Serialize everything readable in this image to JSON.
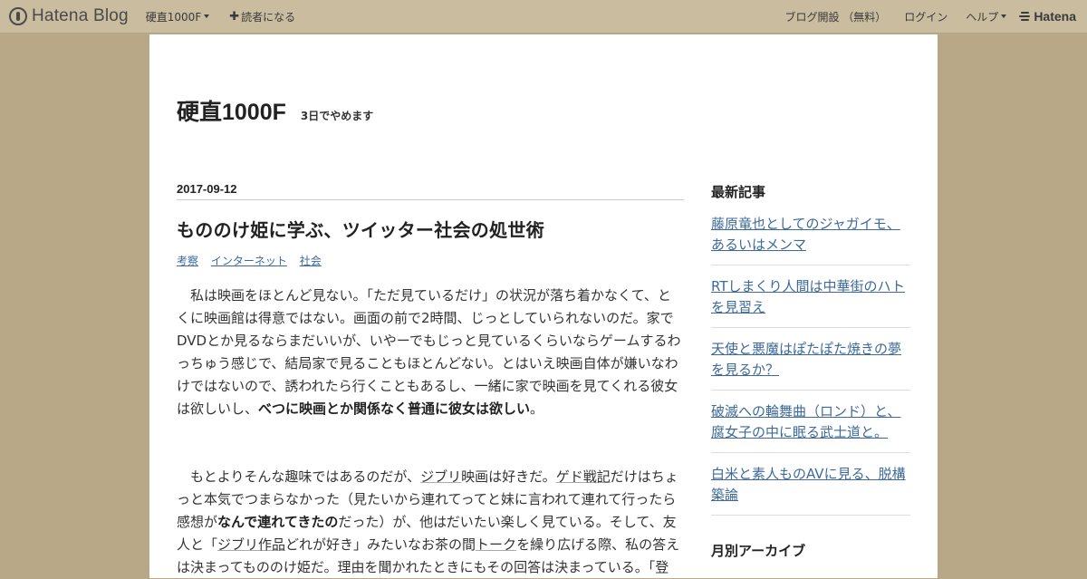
{
  "topbar": {
    "logo_text": "Hatena Blog",
    "left": [
      {
        "label": "硬直1000F",
        "dropdown": true
      },
      {
        "label": "読者になる",
        "plus": true
      }
    ],
    "right": [
      {
        "label": "ブログ開設 （無料）"
      },
      {
        "label": "ログイン"
      },
      {
        "label": "ヘルプ",
        "dropdown": true
      }
    ],
    "hatena_text": "Hatena"
  },
  "blog": {
    "title": "硬直1000F",
    "description": "3日でやめます"
  },
  "entry": {
    "date": "2017-09-12",
    "title": "もののけ姫に学ぶ、ツイッター社会の処世術",
    "categories": [
      "考察",
      "インターネット",
      "社会"
    ],
    "p1": "私は映画をほとんど見ない。「ただ見ているだけ」の状況が落ち着かなくて、とくに映画館は得意ではない。画面の前で2時間、じっとしていられないのだ。家でDVDとか見るならまだいいが、いやーでもじっと見ているくらいならゲームするわっちゅう感じで、結局家で見ることもほとんどない。とはいえ映画自体が嫌いなわけではないので、誘われたら行くこともあるし、一緒に家で映画を見てくれる彼女は欲しいし、",
    "p1_bold": "べつに映画とか関係なく普通に彼女は欲しい",
    "p1_end": "。",
    "p2_a": "もとよりそんな趣味ではあるのだが、",
    "p2_kw1": "ジブリ",
    "p2_b": "映画は好きだ。",
    "p2_kw2": "ゲド戦記",
    "p2_c": "だけはちょっと本気でつまらなかった（見たいから連れてってと妹に言われて連れて行ったら感想が",
    "p2_bold": "なんで連れてきたの",
    "p2_d": "だった）が、他はだいたい楽しく見ている。そして、友人と「",
    "p2_kw3": "ジブリ作品",
    "p2_e": "どれが好き」みたいなお茶の間",
    "p2_kw4": "トーク",
    "p2_f": "を繰り広げる際、私の答えは決まってもののけ姫だ。理由を聞かれたときにもその回答は決まっている。「登"
  },
  "sidebar": {
    "recent_heading": "最新記事",
    "recent": [
      "藤原竜也としてのジャガイモ、あるいはメンマ",
      "RTしまくり人間は中華街のハトを見習え",
      "天使と悪魔はぽたぽた焼きの夢を見るか？",
      "破滅への輪舞曲（ロンド）と、腐女子の中に眠る武士道と。",
      "白米と素人ものAVに見る、脱構築論"
    ],
    "archive_heading": "月別アーカイブ"
  }
}
